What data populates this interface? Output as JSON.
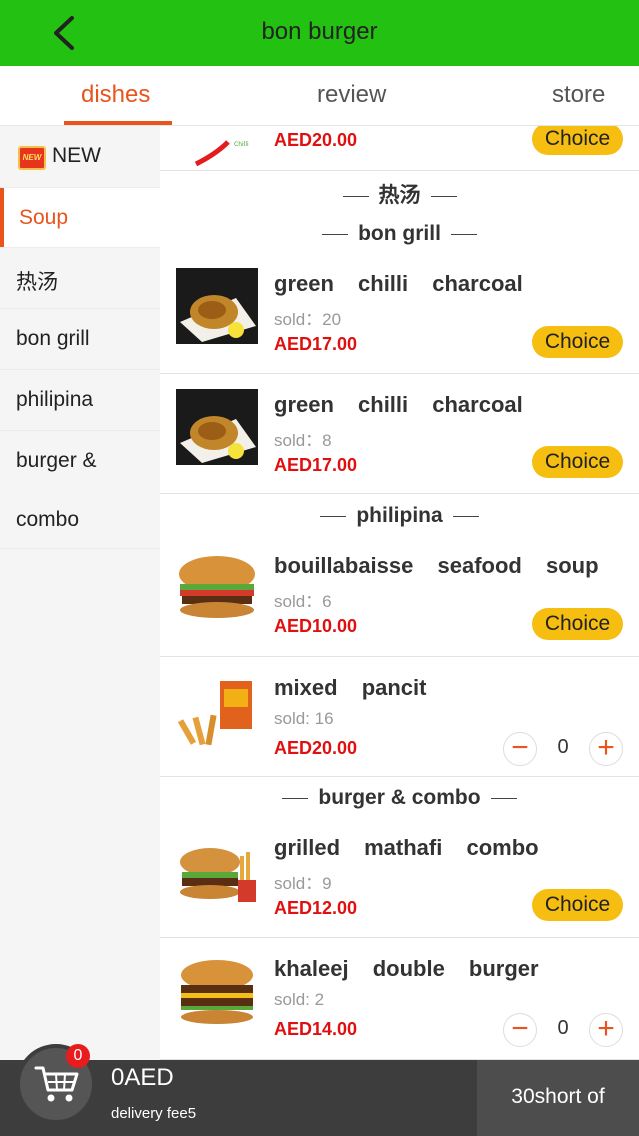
{
  "header": {
    "title": "bon burger"
  },
  "tabs": [
    {
      "label": "dishes"
    },
    {
      "label": "review"
    },
    {
      "label": "store"
    }
  ],
  "sidebar": {
    "items": [
      {
        "label": "NEW",
        "badge": "NEW"
      },
      {
        "label": "Soup"
      },
      {
        "label": "热汤"
      },
      {
        "label": "bon grill"
      },
      {
        "label": "philipina"
      },
      {
        "label": "burger &"
      },
      {
        "label": "combo"
      }
    ]
  },
  "menu": {
    "partial_item": {
      "price": "AED20.00",
      "button": "Choice"
    },
    "sections": {
      "rt": "热汤",
      "grill": "bon grill",
      "philipina": "philipina",
      "burger": "burger & combo"
    },
    "items": [
      {
        "name": "green chilli charcoal",
        "sold": "sold：20",
        "price": "AED17.00",
        "button": "Choice"
      },
      {
        "name": "green chilli charcoal",
        "sold": "sold：8",
        "price": "AED17.00",
        "button": "Choice"
      },
      {
        "name": "bouillabaisse seafood soup",
        "sold": "sold：6",
        "price": "AED10.00",
        "button": "Choice"
      },
      {
        "name": "mixed pancit",
        "sold": "sold: 16",
        "price": "AED20.00",
        "qty": "0"
      },
      {
        "name": "grilled mathafi combo",
        "sold": "sold：9",
        "price": "AED12.00",
        "button": "Choice"
      },
      {
        "name": "khaleej double burger",
        "sold": "sold: 2",
        "price": "AED14.00",
        "qty": "0"
      }
    ]
  },
  "cart": {
    "count": "0",
    "total": "0AED",
    "delivery_fee": "delivery fee5",
    "short": "30short of"
  },
  "colors": {
    "header": "#23c212",
    "accent": "#e8541c",
    "price": "#e01010",
    "choice": "#f5be10"
  }
}
